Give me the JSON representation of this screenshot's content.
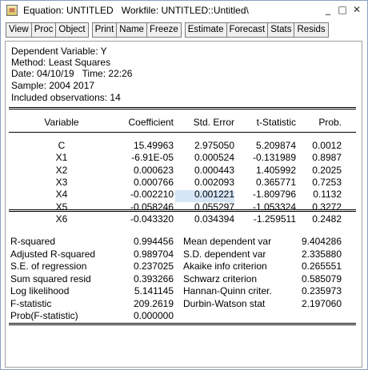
{
  "window": {
    "title": "Equation: UNTITLED   Workfile: UNTITLED::Untitled\\",
    "controls": [
      "_",
      "□",
      "✕"
    ]
  },
  "toolbar": {
    "groups": [
      [
        "View",
        "Proc",
        "Object"
      ],
      [
        "Print",
        "Name",
        "Freeze"
      ],
      [
        "Estimate",
        "Forecast",
        "Stats",
        "Resids"
      ]
    ]
  },
  "header": {
    "dependent": "Dependent Variable: Y",
    "method": "Method: Least Squares",
    "date": "Date: 04/10/19   Time: 22:26",
    "sample": "Sample: 2004 2017",
    "observations": "Included observations: 14"
  },
  "coef_table": {
    "columns": [
      "Variable",
      "Coefficient",
      "Std. Error",
      "t-Statistic",
      "Prob."
    ],
    "rows": [
      [
        "C",
        "15.49963",
        "2.975050",
        "5.209874",
        "0.0012"
      ],
      [
        "X1",
        "-6.91E-05",
        "0.000524",
        "-0.131989",
        "0.8987"
      ],
      [
        "X2",
        "0.000623",
        "0.000443",
        "1.405992",
        "0.2025"
      ],
      [
        "X3",
        "0.000766",
        "0.002093",
        "0.365771",
        "0.7253"
      ],
      [
        "X4",
        "-0.002210",
        "0.001221",
        "-1.809796",
        "0.1132"
      ],
      [
        "X5",
        "-0.058246",
        "0.055297",
        "-1.053324",
        "0.3272"
      ],
      [
        "X6",
        "-0.043320",
        "0.034394",
        "-1.259511",
        "0.2482"
      ]
    ]
  },
  "stats": {
    "left": [
      [
        "R-squared",
        "0.994456"
      ],
      [
        "Adjusted R-squared",
        "0.989704"
      ],
      [
        "S.E. of regression",
        "0.237025"
      ],
      [
        "Sum squared resid",
        "0.393266"
      ],
      [
        "Log likelihood",
        "5.141145"
      ],
      [
        "F-statistic",
        "209.2619"
      ],
      [
        "Prob(F-statistic)",
        "0.000000"
      ]
    ],
    "right": [
      [
        "Mean dependent var",
        "9.404286"
      ],
      [
        "S.D. dependent var",
        "2.335880"
      ],
      [
        "Akaike info criterion",
        "0.265551"
      ],
      [
        "Schwarz criterion",
        "0.585079"
      ],
      [
        "Hannan-Quinn criter.",
        "0.235973"
      ],
      [
        "Durbin-Watson stat",
        "2.197060"
      ]
    ]
  }
}
